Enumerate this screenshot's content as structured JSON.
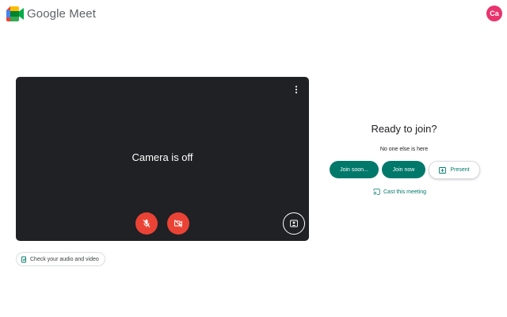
{
  "header": {
    "app_name": "Google Meet",
    "avatar_initials": "Ca"
  },
  "preview": {
    "status_text": "Camera is off",
    "icons": {
      "more": "more-vert-icon",
      "mic": "mic-off-icon",
      "camera": "videocam-off-icon",
      "effects": "visual-effects-icon"
    }
  },
  "check_audio": {
    "label": "Check your audio and video"
  },
  "join_panel": {
    "title": "Ready to join?",
    "subtitle": "No one else is here",
    "join_soon_label": "Join soon...",
    "join_now_label": "Join now",
    "present_label": "Present",
    "cast_label": "Cast this meeting"
  },
  "colors": {
    "accent": "#00796b",
    "danger": "#ea4335",
    "preview_bg": "#202124",
    "avatar_bg": "#e8336d"
  }
}
